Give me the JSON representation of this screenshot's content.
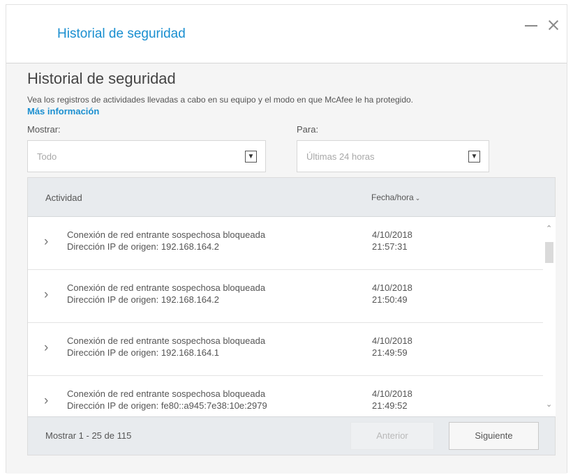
{
  "window": {
    "title": "Historial de seguridad"
  },
  "page": {
    "heading": "Historial de seguridad",
    "description": "Vea los registros de actividades llevadas a cabo en su equipo y el modo en que McAfee le ha protegido.",
    "more_info": "Más información"
  },
  "filters": {
    "show_label": "Mostrar:",
    "show_value": "Todo",
    "for_label": "Para:",
    "for_value": "Últimas 24 horas"
  },
  "table": {
    "col_activity": "Actividad",
    "col_datetime": "Fecha/hora",
    "rows": [
      {
        "title": "Conexión de red entrante sospechosa bloqueada",
        "ip": "Dirección IP de origen: 192.168.164.2",
        "date": "4/10/2018",
        "time": "21:57:31"
      },
      {
        "title": "Conexión de red entrante sospechosa bloqueada",
        "ip": "Dirección IP de origen: 192.168.164.2",
        "date": "4/10/2018",
        "time": "21:50:49"
      },
      {
        "title": "Conexión de red entrante sospechosa bloqueada",
        "ip": "Dirección IP de origen: 192.168.164.1",
        "date": "4/10/2018",
        "time": "21:49:59"
      },
      {
        "title": "Conexión de red entrante sospechosa bloqueada",
        "ip": "Dirección IP de origen: fe80::a945:7e38:10e:2979",
        "date": "4/10/2018",
        "time": "21:49:52"
      }
    ]
  },
  "footer": {
    "count": "Mostrar 1 - 25 de 115",
    "prev": "Anterior",
    "next": "Siguiente"
  },
  "icons": {
    "minimize": "minimize-icon",
    "close": "close-icon",
    "dropdown": "chevron-down-icon",
    "expand": "chevron-right-icon",
    "sort": "sort-down-icon"
  },
  "colors": {
    "accent": "#1a8fd0",
    "table_header_bg": "#e8ebee"
  }
}
